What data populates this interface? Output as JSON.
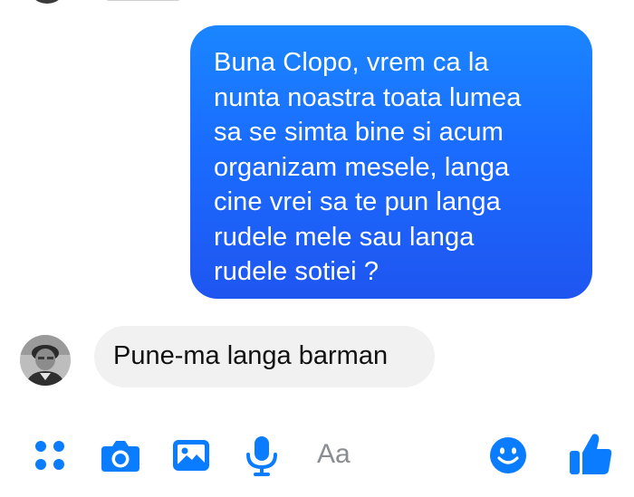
{
  "conversation": {
    "messages": [
      {
        "direction": "outgoing",
        "text": "Buna Clopo, vrem ca la\nnunta noastra toata lumea\nsa se simta bine si acum\norganizam mesele, langa\ncine vrei sa te pun langa\nrudele mele sau langa\nrudele sotiei ?"
      },
      {
        "direction": "incoming",
        "text": "Pune-ma langa barman"
      }
    ]
  },
  "composer": {
    "placeholder": "Aa",
    "icons": {
      "apps": "apps-dots-icon",
      "camera": "camera-icon",
      "gallery": "image-gallery-icon",
      "voice": "microphone-icon",
      "emoji": "smiley-emoji-icon",
      "like": "thumbs-up-icon"
    }
  },
  "colors": {
    "outgoing_bubble": "#1a6cff",
    "incoming_bubble": "#f1f1f1",
    "accent": "#0a7cff"
  }
}
